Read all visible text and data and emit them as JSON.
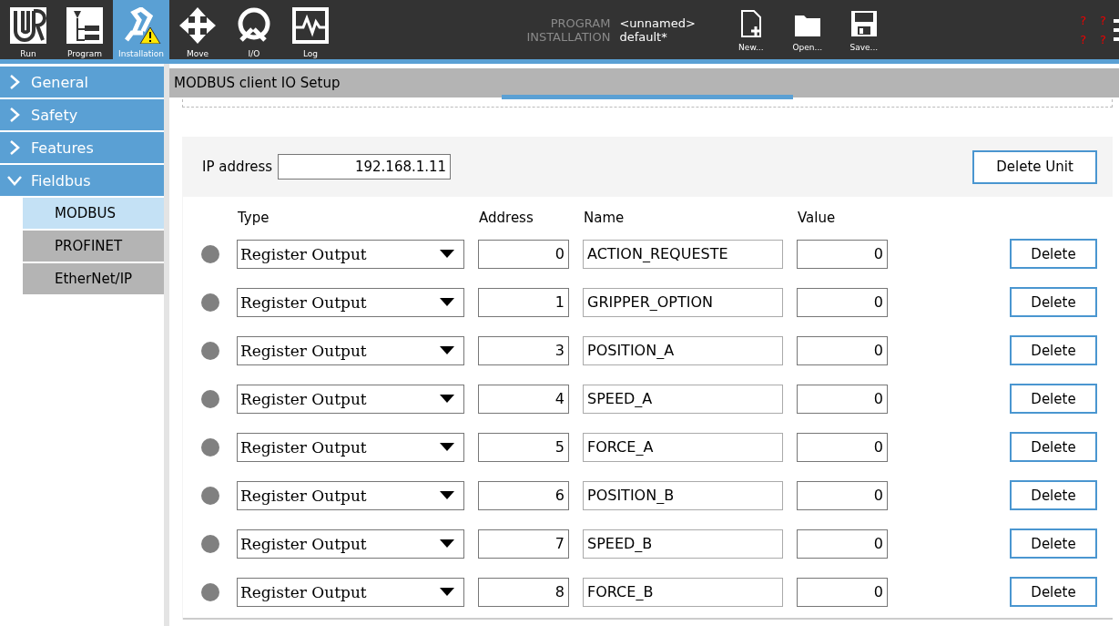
{
  "toolbar": {
    "tabs": [
      {
        "label": "Run",
        "selected": false,
        "kind": "logo"
      },
      {
        "label": "Program",
        "selected": false,
        "kind": "tree"
      },
      {
        "label": "Installation",
        "selected": true,
        "kind": "robot"
      },
      {
        "label": "Move",
        "selected": false,
        "kind": "move"
      },
      {
        "label": "I/O",
        "selected": false,
        "kind": "io"
      },
      {
        "label": "Log",
        "selected": false,
        "kind": "log"
      }
    ],
    "program_label": "PROGRAM",
    "program_value": "<unnamed>",
    "installation_label": "INSTALLATION",
    "installation_value": "default*",
    "file_buttons": [
      {
        "label": "New...",
        "kind": "new"
      },
      {
        "label": "Open...",
        "kind": "open"
      },
      {
        "label": "Save...",
        "kind": "save"
      }
    ],
    "status_marks": [
      "?",
      "?",
      "?",
      "?"
    ]
  },
  "sidebar": {
    "items": [
      {
        "label": "General",
        "expanded": false
      },
      {
        "label": "Safety",
        "expanded": false
      },
      {
        "label": "Features",
        "expanded": false
      },
      {
        "label": "Fieldbus",
        "expanded": true,
        "children": [
          {
            "label": "MODBUS",
            "selected": true
          },
          {
            "label": "PROFINET",
            "selected": false
          },
          {
            "label": "EtherNet/IP",
            "selected": false
          }
        ]
      }
    ]
  },
  "panel": {
    "title": "MODBUS client IO Setup",
    "ip_label": "IP address",
    "ip_value": "192.168.1.11",
    "delete_unit": "Delete Unit",
    "columns": [
      "Type",
      "Address",
      "Name",
      "Value"
    ],
    "signals": [
      {
        "type": "Register Output",
        "address": "0",
        "name": "ACTION_REQUESTE",
        "value": "0",
        "delete": "Delete"
      },
      {
        "type": "Register Output",
        "address": "1",
        "name": "GRIPPER_OPTION",
        "value": "0",
        "delete": "Delete"
      },
      {
        "type": "Register Output",
        "address": "3",
        "name": "POSITION_A",
        "value": "0",
        "delete": "Delete"
      },
      {
        "type": "Register Output",
        "address": "4",
        "name": "SPEED_A",
        "value": "0",
        "delete": "Delete"
      },
      {
        "type": "Register Output",
        "address": "5",
        "name": "FORCE_A",
        "value": "0",
        "delete": "Delete"
      },
      {
        "type": "Register Output",
        "address": "6",
        "name": "POSITION_B",
        "value": "0",
        "delete": "Delete"
      },
      {
        "type": "Register Output",
        "address": "7",
        "name": "SPEED_B",
        "value": "0",
        "delete": "Delete"
      },
      {
        "type": "Register Output",
        "address": "8",
        "name": "FORCE_B",
        "value": "0",
        "delete": "Delete"
      }
    ]
  }
}
